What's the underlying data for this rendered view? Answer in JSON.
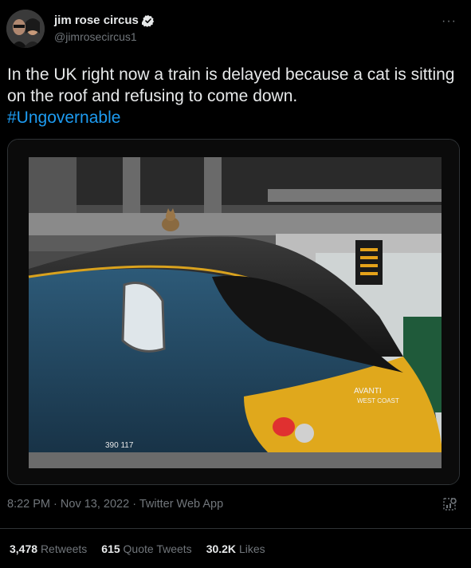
{
  "author": {
    "name": "jim rose circus",
    "handle": "@jimrosecircus1"
  },
  "tweet": {
    "text": "In the UK right now a train is delayed because a cat is sitting on the roof and refusing to come down.",
    "hashtag": "#Ungovernable"
  },
  "media": {
    "description_icons": [
      "train-photo",
      "cat-on-roof"
    ],
    "train_lettering": [
      "AVANTI",
      "WEST COAST"
    ],
    "train_number": "390 117"
  },
  "meta": {
    "time": "8:22 PM",
    "separator": "·",
    "date": "Nov 13, 2022",
    "source": "Twitter Web App"
  },
  "stats": [
    {
      "count": "3,478",
      "label": "Retweets"
    },
    {
      "count": "615",
      "label": "Quote Tweets"
    },
    {
      "count": "30.2K",
      "label": "Likes"
    }
  ],
  "colors": {
    "background": "#000000",
    "text": "#e7e9ea",
    "muted": "#71767b",
    "link": "#1d9bf0",
    "border": "#2f3336"
  }
}
